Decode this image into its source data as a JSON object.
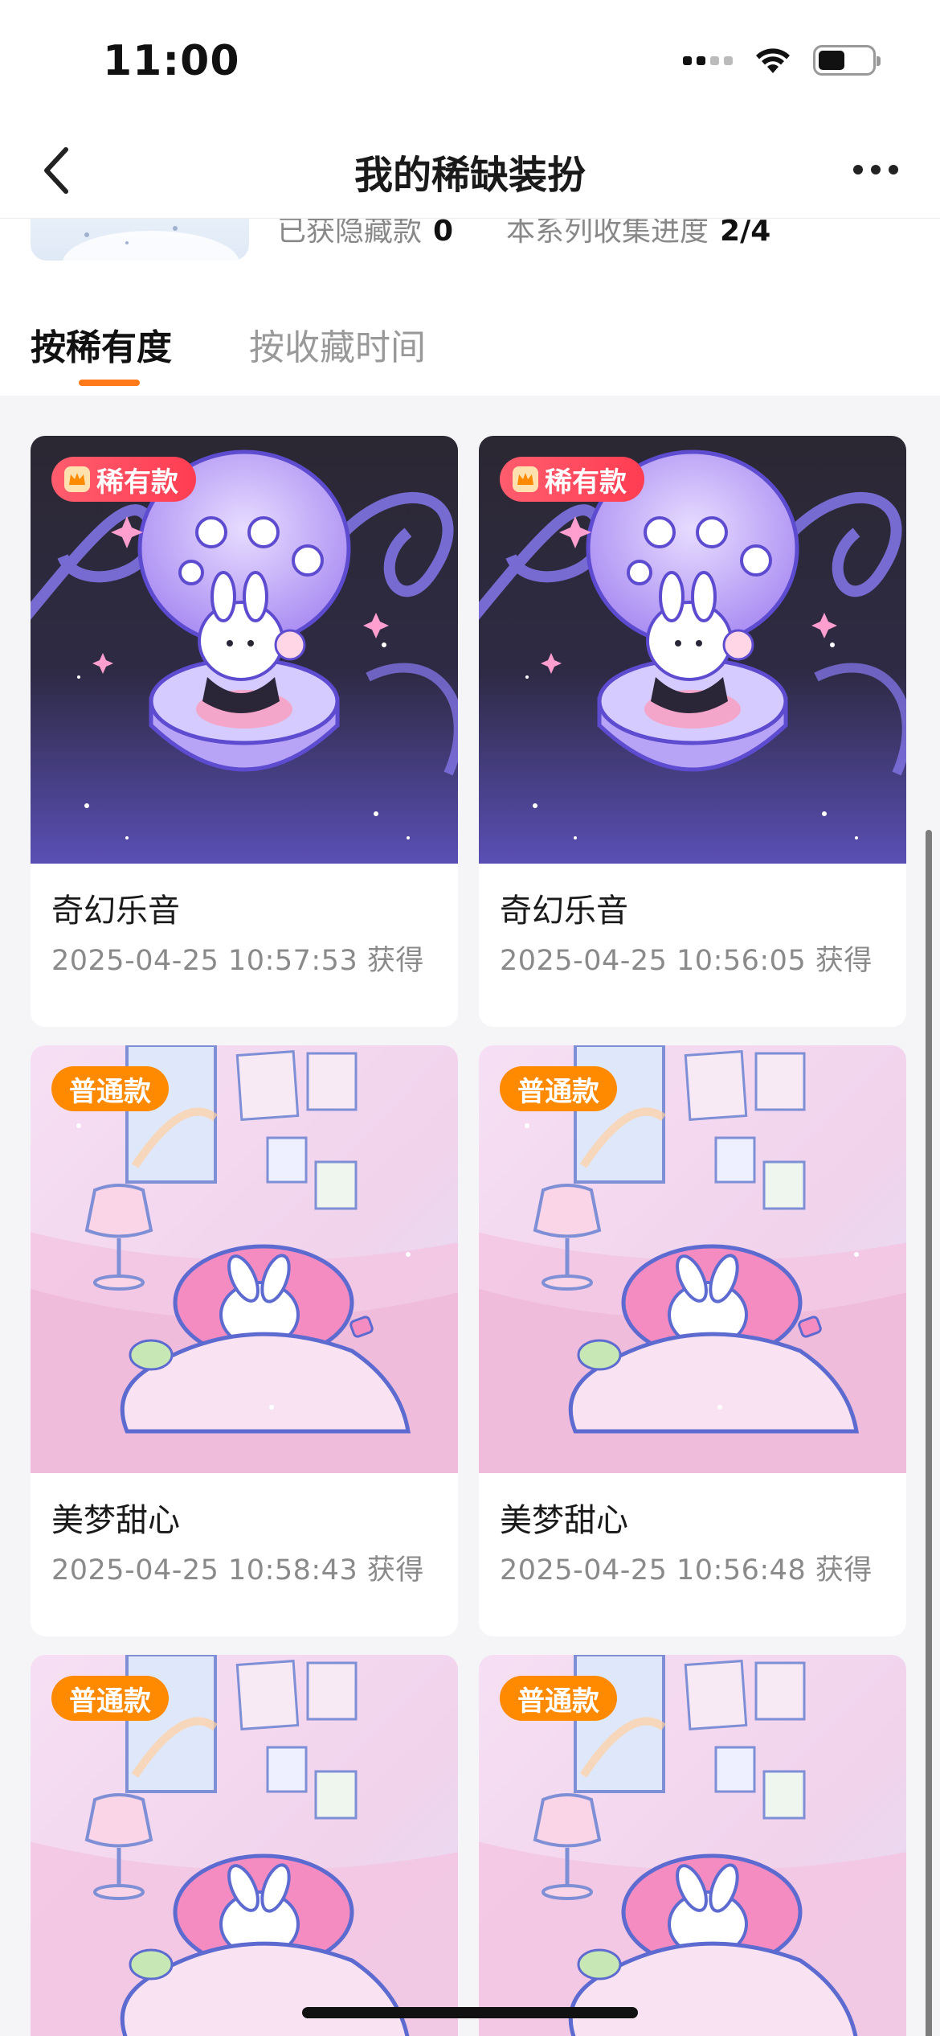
{
  "status": {
    "time": "11:00"
  },
  "nav": {
    "title": "我的稀缺装扮"
  },
  "summary": {
    "hidden_label": "已获隐藏款",
    "hidden_value": "0",
    "progress_label": "本系列收集进度",
    "progress_value": "2/4"
  },
  "tabs": [
    {
      "label": "按稀有度",
      "active": true
    },
    {
      "label": "按收藏时间",
      "active": false
    }
  ],
  "cards": [
    {
      "badge": "稀有款",
      "badge_type": "rare",
      "title": "奇幻乐音",
      "time": "2025-04-25 10:57:53 获得",
      "art": "music-box"
    },
    {
      "badge": "稀有款",
      "badge_type": "rare",
      "title": "奇幻乐音",
      "time": "2025-04-25 10:56:05 获得",
      "art": "music-box"
    },
    {
      "badge": "普通款",
      "badge_type": "normal",
      "title": "美梦甜心",
      "time": "2025-04-25 10:58:43 获得",
      "art": "sleeping-bunny"
    },
    {
      "badge": "普通款",
      "badge_type": "normal",
      "title": "美梦甜心",
      "time": "2025-04-25 10:56:48 获得",
      "art": "sleeping-bunny"
    },
    {
      "badge": "普通款",
      "badge_type": "normal",
      "title": "",
      "time": "",
      "art": "sleeping-bunny"
    },
    {
      "badge": "普通款",
      "badge_type": "normal",
      "title": "",
      "time": "",
      "art": "sleeping-bunny"
    }
  ],
  "colors": {
    "accent": "#ff7a1a",
    "rare_badge": "#ff4a5e",
    "normal_badge": "#ff8a00"
  }
}
